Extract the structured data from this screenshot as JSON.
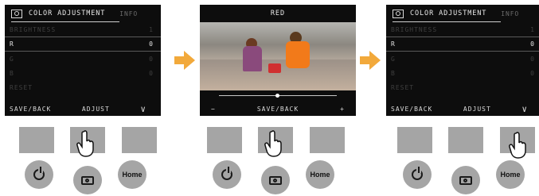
{
  "screen1": {
    "tab_active": "COLOR ADJUSTMENT",
    "tab_inactive": "INFO",
    "rows": [
      {
        "label": "BRIGHTNESS",
        "value": "1"
      },
      {
        "label": "R",
        "value": "0"
      },
      {
        "label": "G",
        "value": "0"
      },
      {
        "label": "B",
        "value": "0"
      },
      {
        "label": "RESET",
        "value": ""
      }
    ],
    "footer": {
      "left": "SAVE/BACK",
      "middle": "ADJUST",
      "right": "∨"
    }
  },
  "screen2": {
    "title": "RED",
    "footer": {
      "left": "−",
      "middle": "SAVE/BACK",
      "right": "+"
    }
  },
  "screen3": {
    "tab_active": "COLOR ADJUSTMENT",
    "tab_inactive": "INFO",
    "rows": [
      {
        "label": "BRIGHTNESS",
        "value": "1"
      },
      {
        "label": "R",
        "value": "0"
      },
      {
        "label": "G",
        "value": "0"
      },
      {
        "label": "B",
        "value": "0"
      },
      {
        "label": "RESET",
        "value": ""
      }
    ],
    "footer": {
      "left": "SAVE/BACK",
      "middle": "ADJUST",
      "right": "∨"
    }
  },
  "controls": {
    "home_label": "Home"
  },
  "colors": {
    "arrow": "#f2a93b",
    "button": "#a5a5a5"
  }
}
